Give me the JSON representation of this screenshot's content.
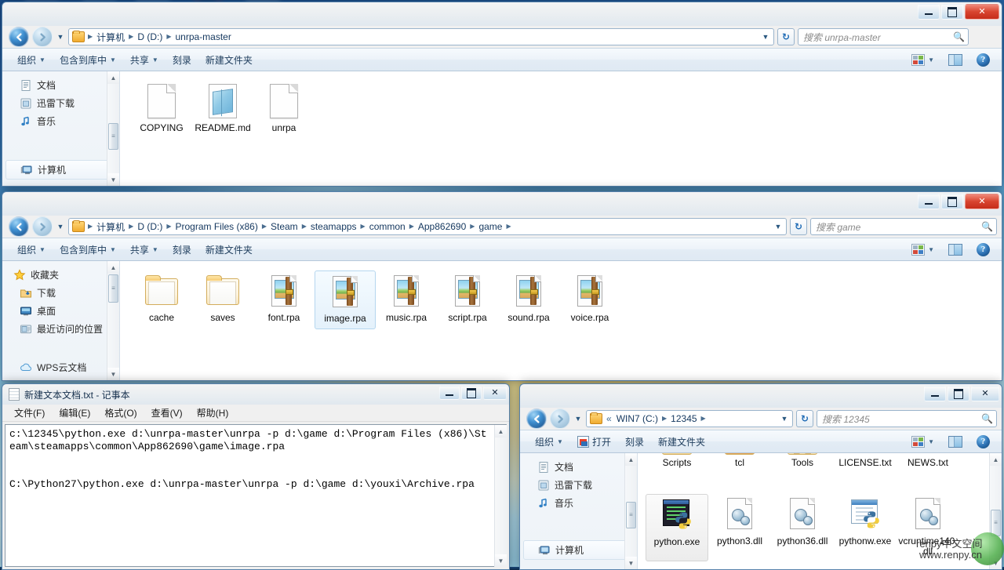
{
  "desktop": {
    "taskbar_visible": true
  },
  "window1": {
    "title": "unrpa-master",
    "caption": {
      "minimize": "–",
      "maximize": "□",
      "close": "✕"
    },
    "breadcrumbs": [
      "计算机",
      "D (D:)",
      "unrpa-master"
    ],
    "search_placeholder": "搜索 unrpa-master",
    "toolbar": [
      {
        "label": "组织",
        "caret": true
      },
      {
        "label": "包含到库中",
        "caret": true
      },
      {
        "label": "共享",
        "caret": true
      },
      {
        "label": "刻录",
        "caret": false
      },
      {
        "label": "新建文件夹",
        "caret": false
      }
    ],
    "nav_items": [
      {
        "label": "文档",
        "icon": "document-icon",
        "selected": false
      },
      {
        "label": "迅雷下载",
        "icon": "download-icon",
        "selected": false
      },
      {
        "label": "音乐",
        "icon": "music-icon",
        "selected": false
      },
      {
        "label": "计算机",
        "icon": "computer-icon",
        "selected": true
      }
    ],
    "files": [
      {
        "name": "COPYING",
        "icon": "blank-document-icon",
        "selected": false
      },
      {
        "name": "README.md",
        "icon": "markdown-document-icon",
        "selected": false
      },
      {
        "name": "unrpa",
        "icon": "blank-document-icon",
        "selected": false
      }
    ]
  },
  "window2": {
    "title": "game",
    "caption": {
      "minimize": "–",
      "maximize": "□",
      "close": "✕"
    },
    "breadcrumbs": [
      "计算机",
      "D (D:)",
      "Program Files (x86)",
      "Steam",
      "steamapps",
      "common",
      "App862690",
      "game"
    ],
    "search_placeholder": "搜索 game",
    "toolbar": [
      {
        "label": "组织",
        "caret": true
      },
      {
        "label": "包含到库中",
        "caret": true
      },
      {
        "label": "共享",
        "caret": true
      },
      {
        "label": "刻录",
        "caret": false
      },
      {
        "label": "新建文件夹",
        "caret": false
      }
    ],
    "nav_items": [
      {
        "label": "收藏夹",
        "icon": "star-favorites-icon",
        "selected": false
      },
      {
        "label": "下载",
        "icon": "downloads-folder-icon",
        "selected": false
      },
      {
        "label": "桌面",
        "icon": "desktop-icon",
        "selected": false
      },
      {
        "label": "最近访问的位置",
        "icon": "recent-places-icon",
        "selected": false
      },
      {
        "label": "WPS云文档",
        "icon": "cloud-icon",
        "selected": false
      }
    ],
    "files": [
      {
        "name": "cache",
        "icon": "folder-icon",
        "selected": false
      },
      {
        "name": "saves",
        "icon": "folder-icon",
        "selected": false
      },
      {
        "name": "font.rpa",
        "icon": "rpa-archive-icon",
        "selected": false
      },
      {
        "name": "image.rpa",
        "icon": "rpa-archive-icon",
        "selected": true
      },
      {
        "name": "music.rpa",
        "icon": "rpa-archive-icon",
        "selected": false
      },
      {
        "name": "script.rpa",
        "icon": "rpa-archive-icon",
        "selected": false
      },
      {
        "name": "sound.rpa",
        "icon": "rpa-archive-icon",
        "selected": false
      },
      {
        "name": "voice.rpa",
        "icon": "rpa-archive-icon",
        "selected": false
      }
    ]
  },
  "notepad": {
    "title": "新建文本文档.txt - 记事本",
    "caption": {
      "minimize": "–",
      "maximize": "□",
      "close": "✕"
    },
    "menus": [
      {
        "label": "文件(F)"
      },
      {
        "label": "编辑(E)"
      },
      {
        "label": "格式(O)"
      },
      {
        "label": "查看(V)"
      },
      {
        "label": "帮助(H)"
      }
    ],
    "content": "c:\\12345\\python.exe d:\\unrpa-master\\unrpa -p d:\\game d:\\Program Files (x86)\\Steam\\steamapps\\common\\App862690\\game\\image.rpa\n\n\nC:\\Python27\\python.exe d:\\unrpa-master\\unrpa -p d:\\game d:\\youxi\\Archive.rpa"
  },
  "window3": {
    "title": "12345",
    "caption": {
      "minimize": "–",
      "maximize": "□",
      "close": "✕"
    },
    "breadcrumbs": [
      "«",
      "WIN7 (C:)",
      "12345"
    ],
    "search_placeholder": "搜索 12345",
    "toolbar": [
      {
        "label": "组织",
        "caret": true
      },
      {
        "label": "打开",
        "caret": false,
        "icon": "open-icon"
      },
      {
        "label": "刻录",
        "caret": false
      },
      {
        "label": "新建文件夹",
        "caret": false
      }
    ],
    "nav_items": [
      {
        "label": "文档",
        "icon": "document-icon",
        "selected": false
      },
      {
        "label": "迅雷下载",
        "icon": "download-icon",
        "selected": false
      },
      {
        "label": "音乐",
        "icon": "music-icon",
        "selected": false
      },
      {
        "label": "计算机",
        "icon": "computer-icon",
        "selected": true
      }
    ],
    "files_row1": [
      {
        "name": "Scripts",
        "icon": "folder-icon",
        "selected": false
      },
      {
        "name": "tcl",
        "icon": "folder-icon",
        "selected": false
      },
      {
        "name": "Tools",
        "icon": "folder-icon",
        "selected": false
      },
      {
        "name": "LICENSE.txt",
        "icon": "text-document-icon",
        "selected": false
      },
      {
        "name": "NEWS.txt",
        "icon": "text-document-icon",
        "selected": false
      }
    ],
    "files_row2": [
      {
        "name": "python.exe",
        "icon": "python-exe-icon",
        "selected": true
      },
      {
        "name": "python3.dll",
        "icon": "dll-icon",
        "selected": false
      },
      {
        "name": "python36.dll",
        "icon": "dll-icon",
        "selected": false
      },
      {
        "name": "pythonw.exe",
        "icon": "pythonw-exe-icon",
        "selected": false
      },
      {
        "name": "vcruntime140.dll",
        "icon": "dll-icon",
        "selected": false
      }
    ]
  },
  "watermark": {
    "line1": "renpy中文空间",
    "line2": "www.renpy.cn"
  }
}
